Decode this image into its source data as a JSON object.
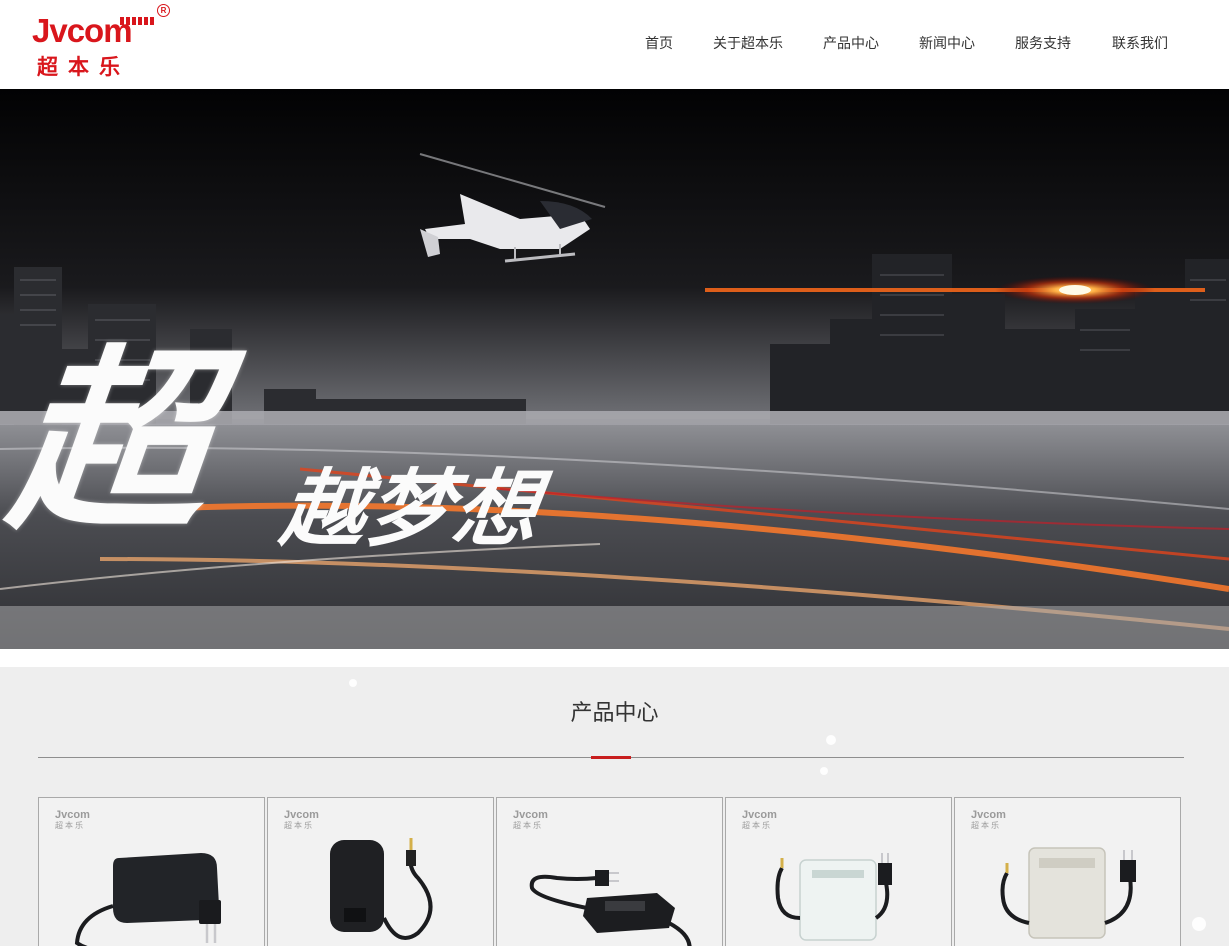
{
  "header": {
    "logo": {
      "wordmark": "Jvcom",
      "cn": "超本乐",
      "reg": "R"
    },
    "nav": [
      {
        "label": "首页"
      },
      {
        "label": "关于超本乐"
      },
      {
        "label": "产品中心"
      },
      {
        "label": "新闻中心"
      },
      {
        "label": "服务支持"
      },
      {
        "label": "联系我们"
      }
    ]
  },
  "banner": {
    "slogan_big": "超",
    "slogan_rest": "越梦想"
  },
  "products": {
    "title": "产品中心",
    "accent_color": "#c81e1e",
    "items": [
      {
        "logo_word": "Jvcom",
        "logo_cn": "超本乐",
        "icon": "wall-adapter-icon"
      },
      {
        "logo_word": "Jvcom",
        "logo_cn": "超本乐",
        "icon": "wall-adapter-icon"
      },
      {
        "logo_word": "Jvcom",
        "logo_cn": "超本乐",
        "icon": "desktop-adapter-icon"
      },
      {
        "logo_word": "Jvcom",
        "logo_cn": "超本乐",
        "icon": "waterproof-power-box-icon"
      },
      {
        "logo_word": "Jvcom",
        "logo_cn": "超本乐",
        "icon": "waterproof-power-box-icon"
      }
    ]
  },
  "colors": {
    "brand": "#d9161c",
    "nav_text": "#333333",
    "section_bg": "#eeeeee"
  }
}
